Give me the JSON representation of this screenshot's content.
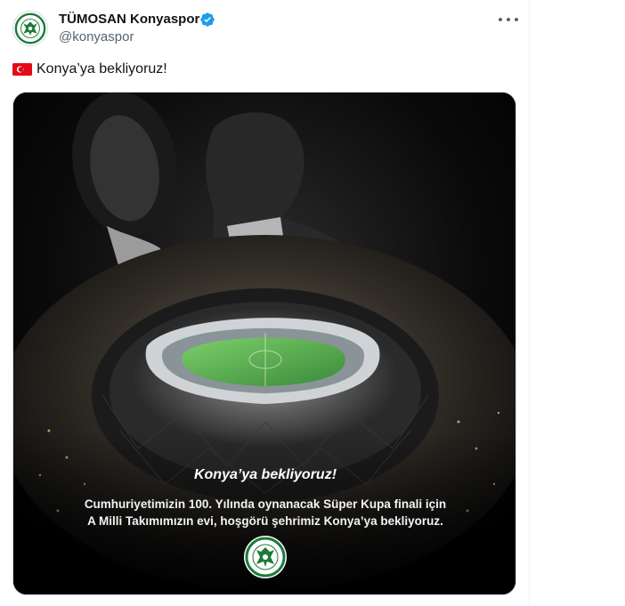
{
  "account": {
    "display_name": "TÜMOSAN Konyaspor",
    "handle": "@konyaspor",
    "avatar_text": "KONYASPOR",
    "verified_icon": "verified-badge-icon"
  },
  "tweet": {
    "flag_icon": "turkey-flag-icon",
    "text": "Konya’ya bekliyoruz!",
    "more_icon": "more-options-icon"
  },
  "media": {
    "headline": "Konya’ya bekliyoruz!",
    "line1": "Cumhuriyetimizin 100. Yılında oynanacak Süper Kupa finali için",
    "line2": "A Milli Takımımızın evi, hoşgörü şehrimiz Konya’ya bekliyoruz.",
    "logo_text": "KONYASPOR"
  },
  "colors": {
    "accent_blue": "#1d9bf0",
    "club_green": "#1e7a3a",
    "flag_red": "#e30a17"
  }
}
